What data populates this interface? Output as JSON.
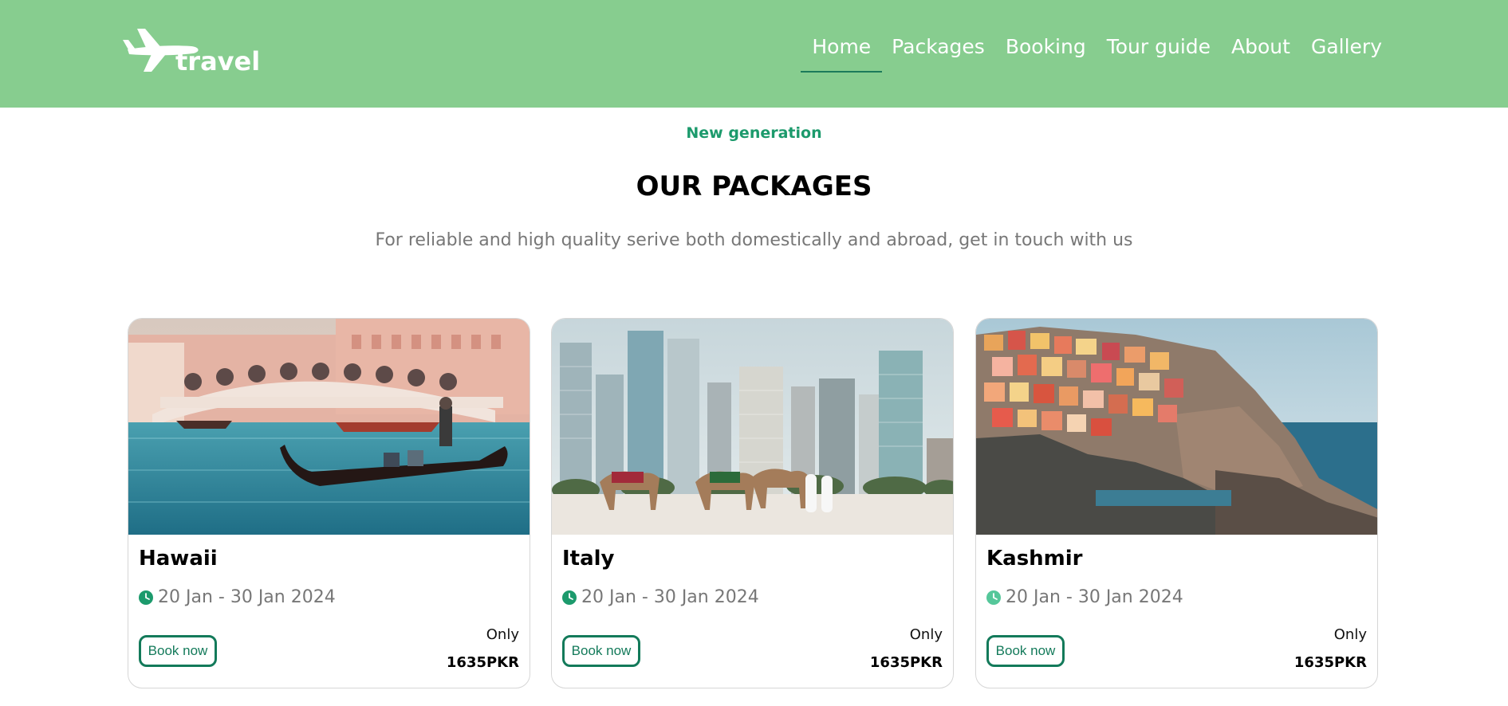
{
  "brand": {
    "logo_text": "travel"
  },
  "nav": {
    "items": [
      {
        "label": "Home",
        "active": true
      },
      {
        "label": "Packages"
      },
      {
        "label": "Booking"
      },
      {
        "label": "Tour guide"
      },
      {
        "label": "About"
      },
      {
        "label": "Gallery"
      }
    ]
  },
  "hero": {
    "eyebrow": "New generation",
    "title": "OUR PACKAGES",
    "subtitle": "For reliable and high quality serive both domestically and abroad, get in touch with us"
  },
  "colors": {
    "nav_bg": "#87cd8f",
    "accent_green": "#1c9a6c",
    "button_border": "#137a5a"
  },
  "packages": [
    {
      "name": "Hawaii",
      "date": "20 Jan - 30 Jan 2024",
      "book_label": "Book now",
      "price_prefix": "Only",
      "price": "1635PKR",
      "clock_color": "#1c9a6c"
    },
    {
      "name": "Italy",
      "date": "20 Jan - 30 Jan 2024",
      "book_label": "Book now",
      "price_prefix": "Only",
      "price": "1635PKR",
      "clock_color": "#1c9a6c"
    },
    {
      "name": "Kashmir",
      "date": "20 Jan - 30 Jan 2024",
      "book_label": "Book now",
      "price_prefix": "Only",
      "price": "1635PKR",
      "clock_color": "#55c79a"
    }
  ]
}
